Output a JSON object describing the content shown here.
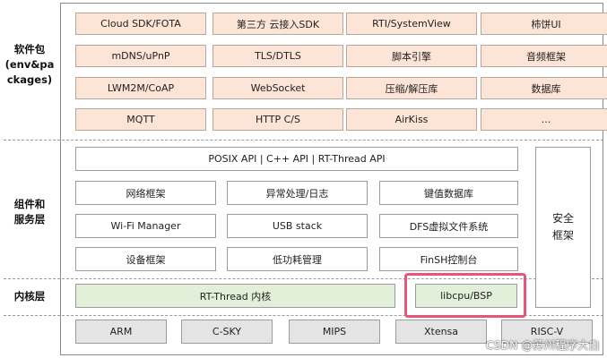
{
  "layers": {
    "software_packages": "软件包\n(env&pa\nckages)",
    "components_services": "组件和\n服务层",
    "kernel": "内核层"
  },
  "packages": [
    [
      "Cloud SDK/FOTA",
      "第三方 云接入SDK",
      "RTI/SystemView",
      "柿饼UI"
    ],
    [
      "mDNS/uPnP",
      "TLS/DTLS",
      "脚本引擎",
      "音频框架"
    ],
    [
      "LWM2M/CoAP",
      "WebSocket",
      "压缩/解压库",
      "数据库"
    ],
    [
      "MQTT",
      "HTTP C/S",
      "AirKiss",
      "..."
    ]
  ],
  "api_bar": "POSIX API  |  C++ API  |  RT-Thread API",
  "components": [
    [
      "网络框架",
      "异常处理/日志",
      "键值数据库"
    ],
    [
      "Wi-Fi Manager",
      "USB stack",
      "DFS虚拟文件系统"
    ],
    [
      "设备框架",
      "低功耗管理",
      "FinSH控制台"
    ]
  ],
  "security": [
    "安全",
    "框架"
  ],
  "kernel": {
    "core": "RT-Thread  内核",
    "bsp": "libcpu/BSP"
  },
  "arch": [
    "ARM",
    "C-SKY",
    "MIPS",
    "Xtensa",
    "RISC-V"
  ],
  "watermark": "CSDN @苏州程序大白",
  "colors": {
    "package": "#fce4d6",
    "kernel": "#e2efd9",
    "arch": "#e4e4e4",
    "highlight": "#e8557a"
  }
}
